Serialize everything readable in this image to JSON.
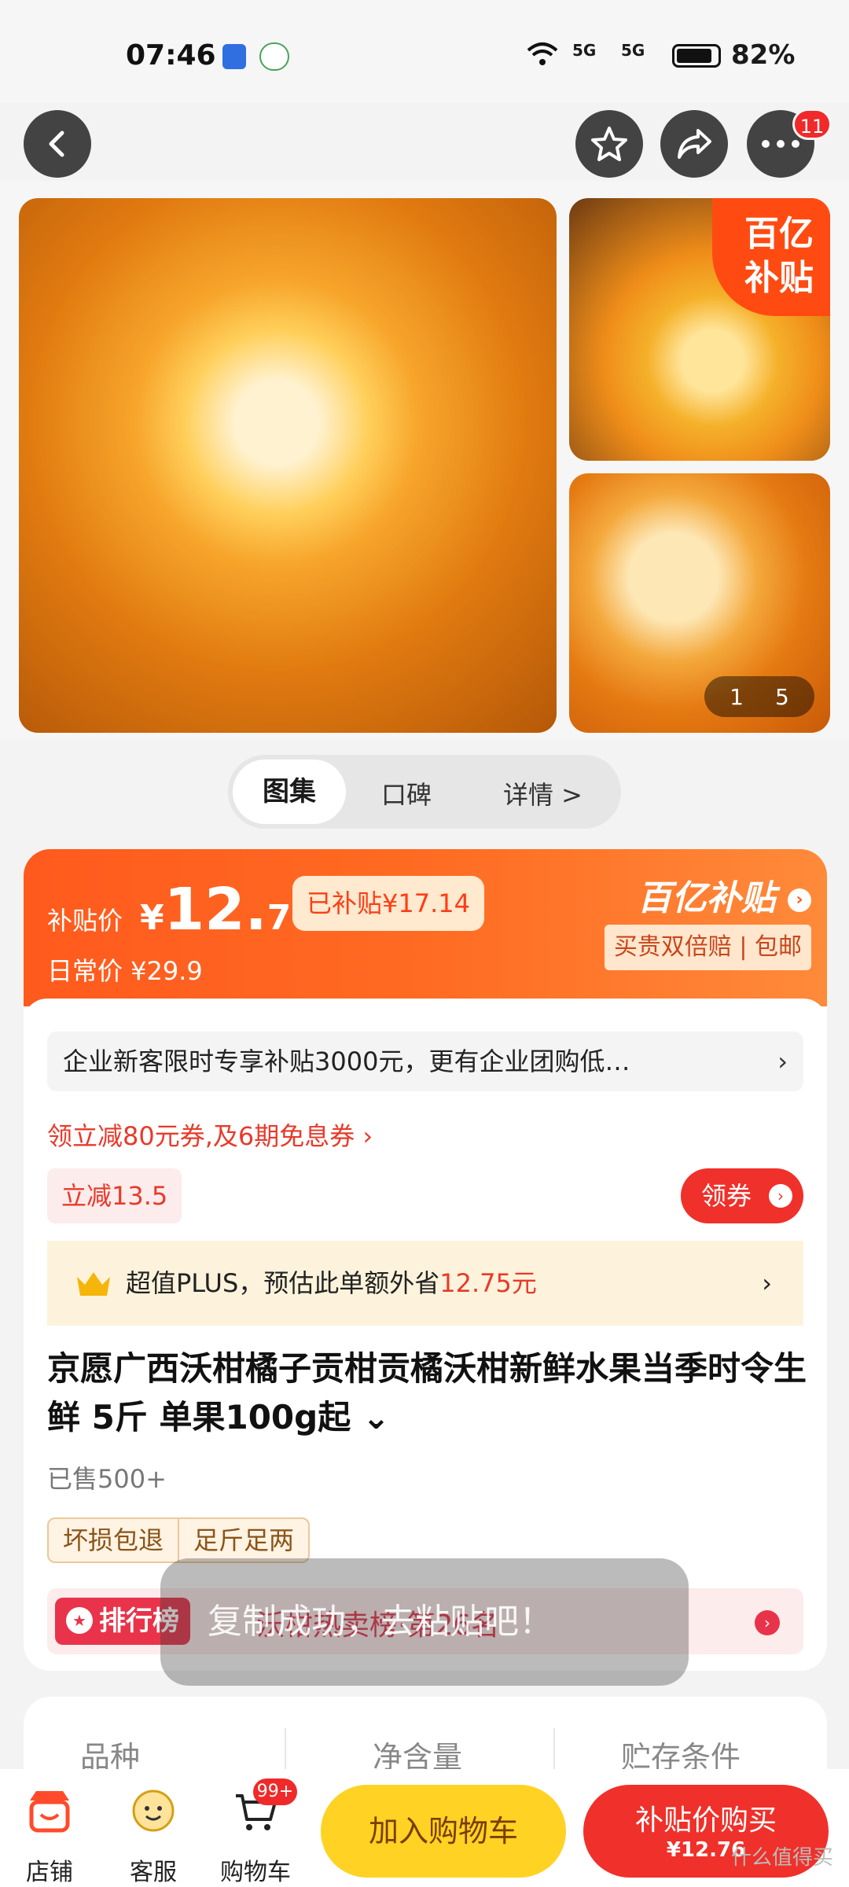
{
  "status_bar": {
    "time": "07:46",
    "signal1": "5G",
    "signal2": "5G",
    "battery": "82%"
  },
  "nav": {
    "more_badge": "11"
  },
  "gallery": {
    "subsidy_tag_line1": "百亿",
    "subsidy_tag_line2": "补贴",
    "pager_current": "1",
    "pager_total": "5"
  },
  "tabs": [
    {
      "label": "图集"
    },
    {
      "label": "口碑"
    },
    {
      "label": "详情 >"
    }
  ],
  "price": {
    "subsidy_label": "补贴价",
    "currency": "¥",
    "price_int": "12.",
    "price_dec": "76",
    "already_subsidized": "已补贴¥17.14",
    "daily_price": "日常价 ¥29.9",
    "brand": "百亿补贴",
    "guarantee": "买贵双倍赔 | 包邮"
  },
  "promo": {
    "corp_text": "企业新客限时专享补贴3000元，更有企业团购低…",
    "coupon_line": "领立减80元券,及6期免息券 ›",
    "reduce_tag": "立减13.5",
    "get_coupon": "领券",
    "plus_prefix": "超值PLUS，预估此单额外省",
    "plus_amount": "12.75元"
  },
  "product": {
    "title": "京愿广西沃柑橘子贡柑贡橘沃柑新鲜水果当季时令生鲜 5斤 单果100g起 ⌄",
    "sold": "已售500+",
    "tags": [
      "坏损包退",
      "足斤足两"
    ],
    "rank_badge": "排行榜",
    "rank_text": "沃柑热卖榜·第26名"
  },
  "toast": "复制成功，去粘贴吧！",
  "specs": [
    "品种",
    "净含量",
    "贮存条件"
  ],
  "bottom": {
    "shop": "店铺",
    "service": "客服",
    "cart": "购物车",
    "cart_badge": "99+",
    "add_to_cart": "加入购物车",
    "buy_line1": "补贴价购买",
    "buy_line2": "¥12.76"
  },
  "watermark": "什么值得买",
  "colors": {
    "accent": "#ff5a1e",
    "cta_red": "#f0302a",
    "cta_yellow": "#ffd224"
  }
}
